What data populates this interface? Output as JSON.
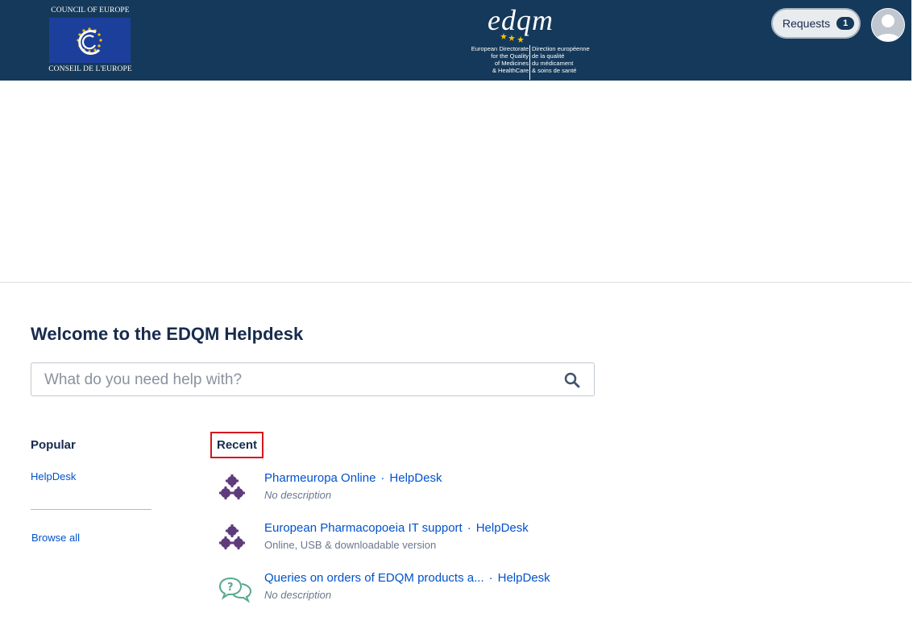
{
  "header": {
    "coe_top_text": "COUNCIL OF EUROPE",
    "coe_bottom_text": "CONSEIL DE L'EUROPE",
    "edqm_wordmark": "edqm",
    "edqm_en": "European Directorate\nfor the Quality\nof Medicines\n& HealthCare",
    "edqm_fr": "Direction européenne\nde la qualité\ndu médicament\n& soins de santé",
    "requests_label": "Requests",
    "requests_count": "1",
    "colors": {
      "bar": "#15395a",
      "flag": "#1d3f9c",
      "star": "#f5c400"
    }
  },
  "main": {
    "welcome": "Welcome to the EDQM Helpdesk",
    "search_placeholder": "What do you need help with?"
  },
  "popular": {
    "heading": "Popular",
    "link": "HelpDesk",
    "browse_all": "Browse all"
  },
  "recent": {
    "heading": "Recent",
    "items": [
      {
        "title": "Pharmeuropa Online",
        "sep": "·",
        "portal": "HelpDesk",
        "desc": "No description",
        "icon": "gears-icon"
      },
      {
        "title": "European Pharmacopoeia IT support",
        "sep": "·",
        "portal": "HelpDesk",
        "desc": "Online, USB & downloadable version",
        "icon": "gears-icon"
      },
      {
        "title": "Queries on orders of EDQM products a...",
        "sep": "·",
        "portal": "HelpDesk",
        "desc": "No description",
        "icon": "chat-question-icon"
      }
    ]
  }
}
